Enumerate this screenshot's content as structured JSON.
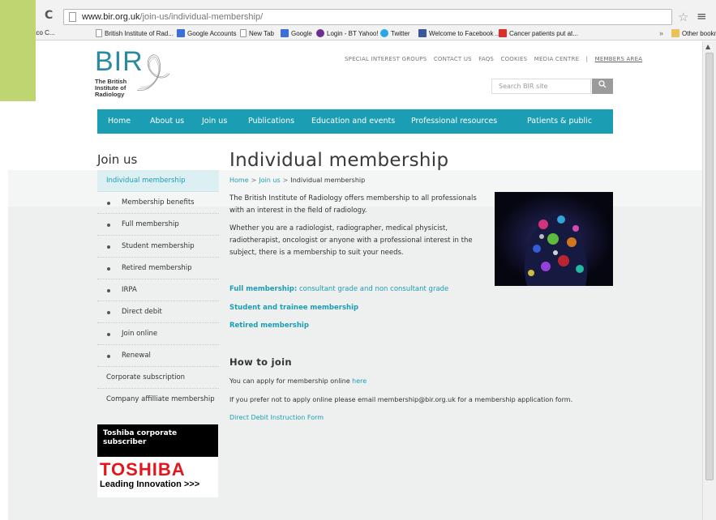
{
  "browser": {
    "url_host": "www.bir.org.uk",
    "url_path": "/join-us/individual-membership/",
    "bookmarks": [
      {
        "label": "tent - Umbraco C...",
        "icon": "page-icon"
      },
      {
        "label": "British Institute of Rad...",
        "icon": "page-icon"
      },
      {
        "label": "Google Accounts",
        "icon": "google-icon"
      },
      {
        "label": "New Tab",
        "icon": "page-icon"
      },
      {
        "label": "Google",
        "icon": "google-icon"
      },
      {
        "label": "Login - BT Yahoo!",
        "icon": "yahoo-icon"
      },
      {
        "label": "Twitter",
        "icon": "twitter-icon"
      },
      {
        "label": "Welcome to Facebook ...",
        "icon": "facebook-icon"
      },
      {
        "label": "Cancer patients put at...",
        "icon": "gmail-icon"
      }
    ],
    "more": "»",
    "other_bookmarks": "Other bookmarks"
  },
  "header": {
    "logo_mark": "BIR",
    "logo_name": "The British Institute of Radiology",
    "utility_links": [
      "SPECIAL INTEREST GROUPS",
      "CONTACT US",
      "FAQS",
      "COOKIES",
      "MEDIA CENTRE",
      "|",
      "MEMBERS AREA"
    ],
    "search_placeholder": "Search BIR site"
  },
  "nav": {
    "items": [
      "Home",
      "About us",
      "Join us",
      "Publications",
      "Education and events",
      "Professional resources",
      "Patients & public"
    ]
  },
  "sidebar": {
    "title": "Join us",
    "items": [
      "Individual membership",
      "Membership benefits",
      "Full membership",
      "Student membership",
      "Retired membership",
      "IRPA",
      "Direct debit",
      "Join online",
      "Renewal",
      "Corporate subscription",
      "Company affilliate membership"
    ],
    "sponsor": {
      "heading": "Toshiba corporate subscriber",
      "logo": "TOSHIBA",
      "tagline": "Leading Innovation >>>"
    }
  },
  "main": {
    "title": "Individual membership",
    "breadcrumb": [
      "Home",
      ">",
      "Join us",
      ">",
      "Individual membership"
    ],
    "intro_1": "The British Institute of Radiology offers membership to all professionals with an interest in the field of radiology.",
    "intro_2": "Whether you are a radiologist, radiographer, medical physicist, radiotherapist, oncologist or anyone with a professional interest in the subject, there is a membership to suit your needs.",
    "links": {
      "full_bold": "Full membership:",
      "full_rest": " consultant grade and non consultant grade",
      "student": "Student and trainee membership",
      "retired": "Retired membership"
    },
    "how_to_join": "How to join",
    "apply_text": "You can apply for membership online ",
    "apply_link": "here",
    "email_text": "If you prefer not to apply online please email membership@bir.org.uk for a membership application form.",
    "direct_debit": "Direct Debit Instruction Form"
  }
}
